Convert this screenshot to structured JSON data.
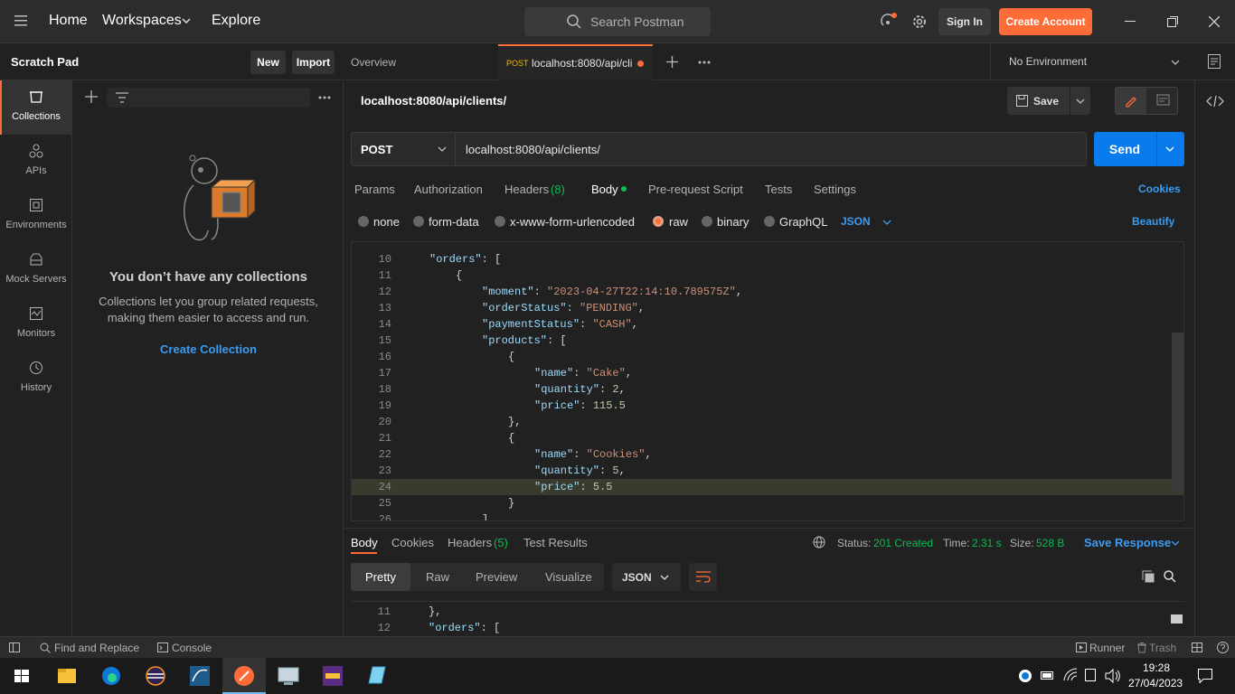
{
  "nav": {
    "home": "Home",
    "workspaces": "Workspaces",
    "explore": "Explore",
    "search_placeholder": "Search Postman",
    "sign_in": "Sign In",
    "create_account": "Create Account"
  },
  "sidebar": {
    "title": "Scratch Pad",
    "new": "New",
    "import": "Import",
    "items": [
      {
        "label": "Collections",
        "icon": "collections-icon"
      },
      {
        "label": "APIs",
        "icon": "apis-icon"
      },
      {
        "label": "Environments",
        "icon": "environments-icon"
      },
      {
        "label": "Mock Servers",
        "icon": "mock-servers-icon"
      },
      {
        "label": "Monitors",
        "icon": "monitors-icon"
      },
      {
        "label": "History",
        "icon": "history-icon"
      }
    ],
    "empty_title": "You don’t have any collections",
    "empty_desc1": "Collections let you group related requests,",
    "empty_desc2": "making them easier to access and run.",
    "create_collection": "Create Collection"
  },
  "tabs": {
    "overview": "Overview",
    "active_method": "POST",
    "active_label": "localhost:8080/api/cli",
    "environment": "No Environment"
  },
  "request": {
    "name": "localhost:8080/api/clients/",
    "save": "Save",
    "method": "POST",
    "url": "localhost:8080/api/clients/",
    "send": "Send",
    "subtabs": [
      "Params",
      "Authorization",
      "Headers",
      "(8)",
      "Body",
      "Pre-request Script",
      "Tests",
      "Settings"
    ],
    "cookies": "Cookies",
    "body_types": [
      "none",
      "form-data",
      "x-www-form-urlencoded",
      "raw",
      "binary",
      "GraphQL"
    ],
    "format": "JSON",
    "beautify": "Beautify"
  },
  "editor": {
    "lines": [
      {
        "n": "10",
        "tokens": [
          [
            "k",
            "\"orders\""
          ],
          [
            "p",
            ": ["
          ]
        ],
        "indent": 1
      },
      {
        "n": "11",
        "tokens": [
          [
            "p",
            "{"
          ]
        ],
        "indent": 2
      },
      {
        "n": "12",
        "tokens": [
          [
            "k",
            "\"moment\""
          ],
          [
            "p",
            ": "
          ],
          [
            "s",
            "\"2023-04-27T22:14:10.789575Z\""
          ],
          [
            "p",
            ","
          ]
        ],
        "indent": 3
      },
      {
        "n": "13",
        "tokens": [
          [
            "k",
            "\"orderStatus\""
          ],
          [
            "p",
            ": "
          ],
          [
            "s",
            "\"PENDING\""
          ],
          [
            "p",
            ","
          ]
        ],
        "indent": 3
      },
      {
        "n": "14",
        "tokens": [
          [
            "k",
            "\"paymentStatus\""
          ],
          [
            "p",
            ": "
          ],
          [
            "s",
            "\"CASH\""
          ],
          [
            "p",
            ","
          ]
        ],
        "indent": 3
      },
      {
        "n": "15",
        "tokens": [
          [
            "k",
            "\"products\""
          ],
          [
            "p",
            ": ["
          ]
        ],
        "indent": 3
      },
      {
        "n": "16",
        "tokens": [
          [
            "p",
            "{"
          ]
        ],
        "indent": 4
      },
      {
        "n": "17",
        "tokens": [
          [
            "k",
            "\"name\""
          ],
          [
            "p",
            ": "
          ],
          [
            "s",
            "\"Cake\""
          ],
          [
            "p",
            ","
          ]
        ],
        "indent": 5
      },
      {
        "n": "18",
        "tokens": [
          [
            "k",
            "\"quantity\""
          ],
          [
            "p",
            ": "
          ],
          [
            "n",
            "2"
          ],
          [
            "p",
            ","
          ]
        ],
        "indent": 5
      },
      {
        "n": "19",
        "tokens": [
          [
            "k",
            "\"price\""
          ],
          [
            "p",
            ": "
          ],
          [
            "n",
            "115.5"
          ]
        ],
        "indent": 5
      },
      {
        "n": "20",
        "tokens": [
          [
            "p",
            "},"
          ]
        ],
        "indent": 4
      },
      {
        "n": "21",
        "tokens": [
          [
            "p",
            "{"
          ]
        ],
        "indent": 4
      },
      {
        "n": "22",
        "tokens": [
          [
            "k",
            "\"name\""
          ],
          [
            "p",
            ": "
          ],
          [
            "s",
            "\"Cookies\""
          ],
          [
            "p",
            ","
          ]
        ],
        "indent": 5
      },
      {
        "n": "23",
        "tokens": [
          [
            "k",
            "\"quantity\""
          ],
          [
            "p",
            ": "
          ],
          [
            "n",
            "5"
          ],
          [
            "p",
            ","
          ]
        ],
        "indent": 5
      },
      {
        "n": "24",
        "tokens": [
          [
            "k",
            "\"price\""
          ],
          [
            "p",
            ": "
          ],
          [
            "n",
            "5.5"
          ]
        ],
        "indent": 5
      },
      {
        "n": "25",
        "tokens": [
          [
            "p",
            "}"
          ]
        ],
        "indent": 4
      },
      {
        "n": "26",
        "tokens": [
          [
            "p",
            "]"
          ]
        ],
        "indent": 3
      }
    ]
  },
  "response": {
    "tabs": [
      "Body",
      "Cookies",
      "Headers",
      "(5)",
      "Test Results"
    ],
    "status_label": "Status:",
    "status": "201 Created",
    "time_label": "Time:",
    "time": "2.31 s",
    "size_label": "Size:",
    "size": "528 B",
    "save_response": "Save Response",
    "views": [
      "Pretty",
      "Raw",
      "Preview",
      "Visualize"
    ],
    "format": "JSON",
    "lines": [
      {
        "n": "11",
        "tokens": [
          [
            "p",
            "},"
          ]
        ]
      },
      {
        "n": "12",
        "tokens": [
          [
            "k",
            "\"orders\""
          ],
          [
            "p",
            ": ["
          ]
        ]
      }
    ]
  },
  "statusbar": {
    "find_replace": "Find and Replace",
    "console": "Console",
    "runner": "Runner",
    "trash": "Trash"
  },
  "taskbar": {
    "time": "19:28",
    "date": "27/04/2023"
  },
  "colors": {
    "accent": "#ff6c37",
    "send": "#097bed",
    "link": "#3a9cf2",
    "success": "#0cbb52"
  }
}
